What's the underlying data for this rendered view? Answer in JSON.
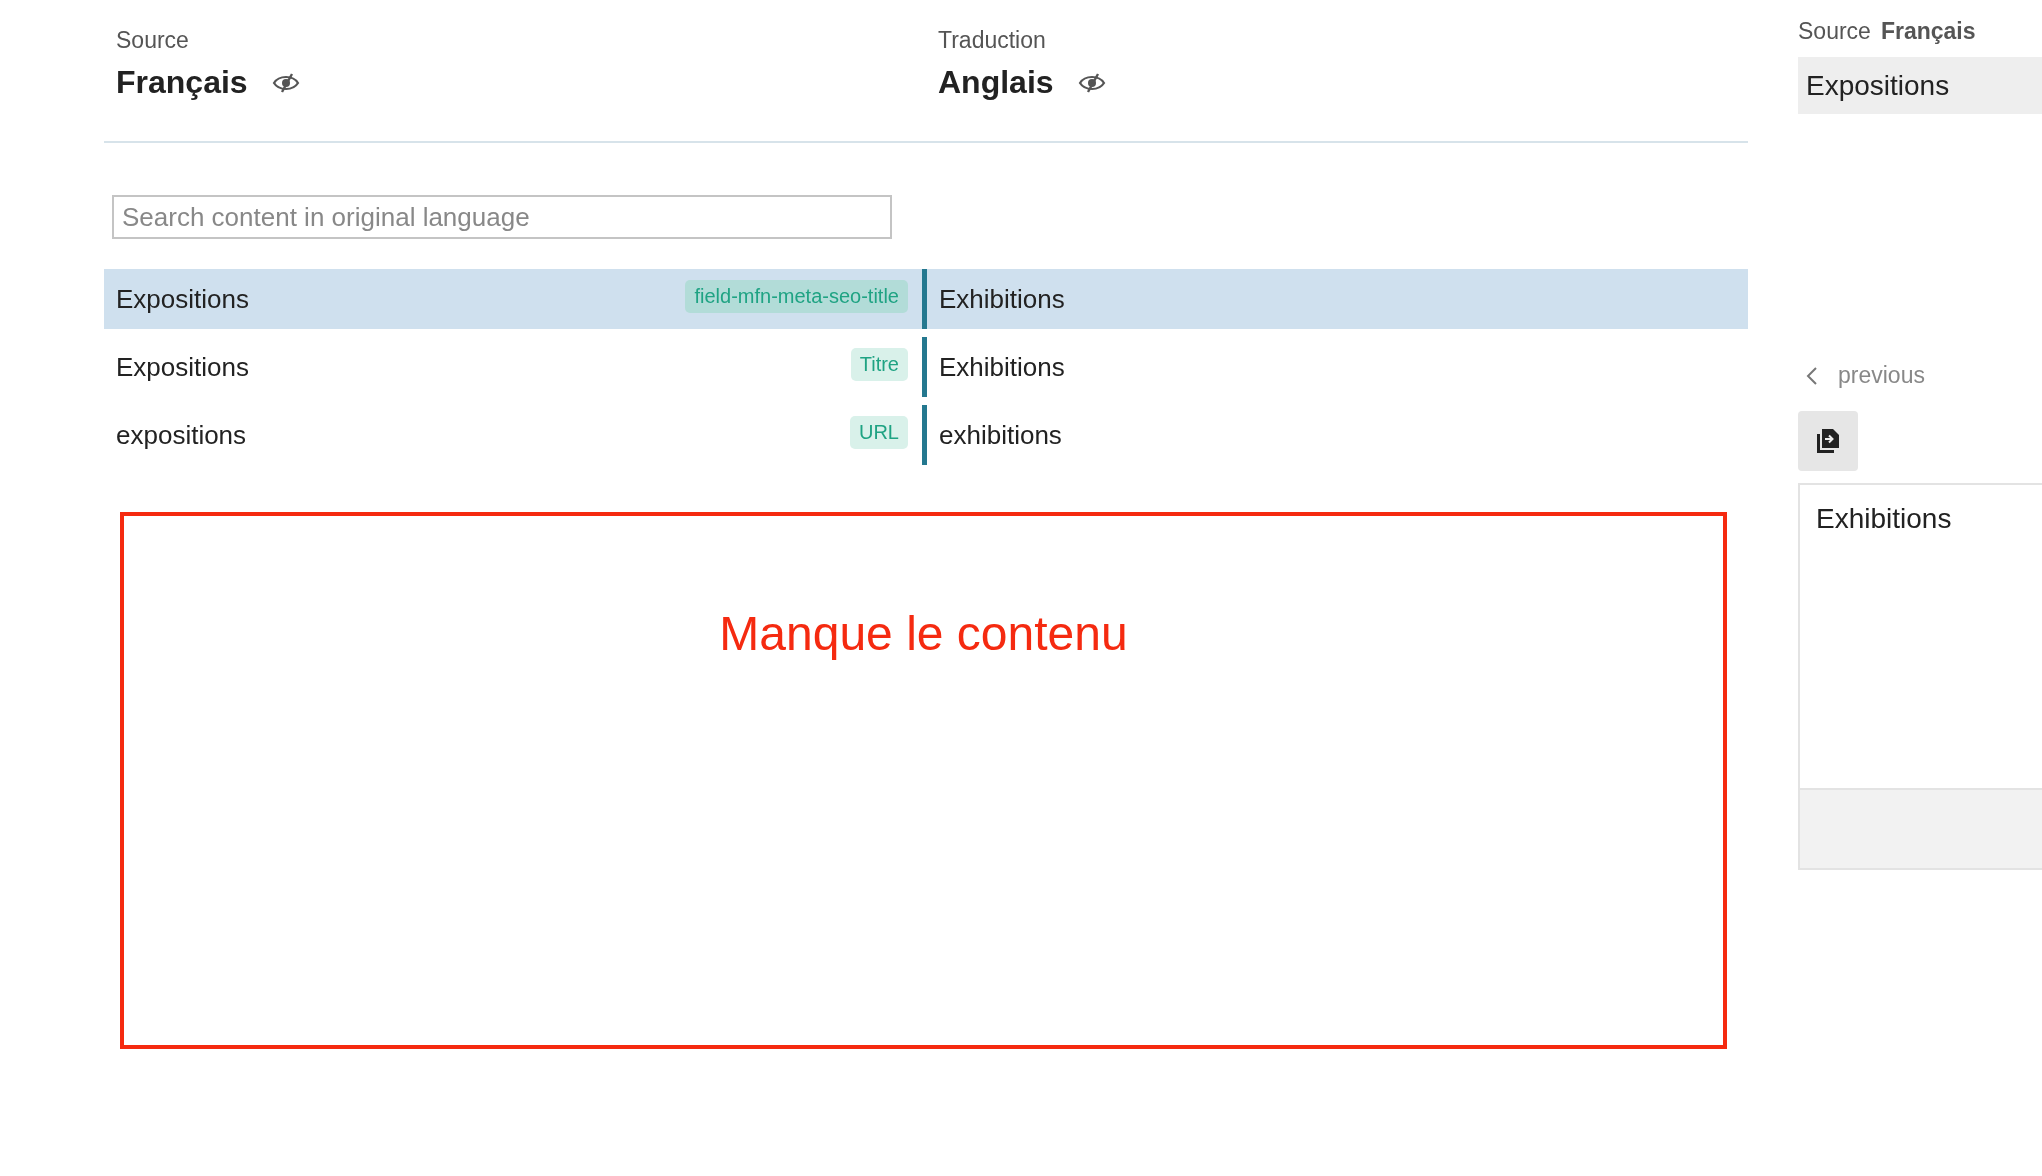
{
  "languages": [
    {
      "label": "Source",
      "name": "Français"
    },
    {
      "label": "Traduction",
      "name": "Anglais"
    }
  ],
  "search": {
    "placeholder": "Search content in original language"
  },
  "rows": [
    {
      "source": "Expositions",
      "tag": "field-mfn-meta-seo-title",
      "translation": "Exhibitions",
      "selected": true
    },
    {
      "source": "Expositions",
      "tag": "Titre",
      "translation": "Exhibitions",
      "selected": false
    },
    {
      "source": "expositions",
      "tag": "URL",
      "translation": "exhibitions",
      "selected": false
    }
  ],
  "annotation": {
    "text": "Manque le contenu"
  },
  "side_panel": {
    "source_label": "Source",
    "source_language": "Français",
    "source_text": "Expositions",
    "previous": "previous",
    "translation_text": "Exhibitions"
  }
}
